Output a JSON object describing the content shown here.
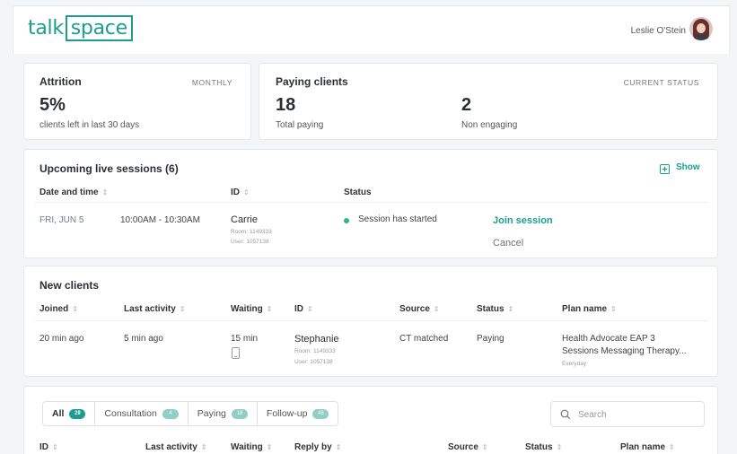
{
  "header": {
    "logo_left": "talk",
    "logo_box": "space",
    "user_name": "Leslie O'Stein"
  },
  "attrition": {
    "title": "Attrition",
    "period": "MONTHLY",
    "value": "5%",
    "caption": "clients left in last 30 days"
  },
  "paying": {
    "title": "Paying clients",
    "status_tag": "CURRENT STATUS",
    "paying_value": "18",
    "paying_caption": "Total paying",
    "non_value": "2",
    "non_caption": "Non engaging"
  },
  "sessions": {
    "title": "Upcoming live sessions (6)",
    "show_label": "Show",
    "columns": [
      "Date and time",
      "ID",
      "Status"
    ],
    "rows": [
      {
        "date": "FRI, JUN 5",
        "time": "10:00AM - 10:30AM",
        "name": "Carrie",
        "room": "Room: 1149333",
        "user": "User: 1057138",
        "status": "Session has started",
        "join": "Join session",
        "cancel": "Cancel"
      }
    ]
  },
  "new_clients": {
    "title": "New clients",
    "columns": [
      "Joined",
      "Last activity",
      "Waiting",
      "ID",
      "Source",
      "Status",
      "Plan name"
    ],
    "rows": [
      {
        "joined": "20 min ago",
        "last_activity": "5 min ago",
        "waiting": "15 min",
        "name": "Stephanie",
        "room": "Room: 1149333",
        "user": "User: 1057138",
        "source": "CT matched",
        "status": "Paying",
        "plan_line1": "Health Advocate EAP 3",
        "plan_line2": "Sessions Messaging Therapy...",
        "plan_sub": "Everyday"
      }
    ]
  },
  "clients": {
    "tabs": [
      {
        "label": "All",
        "count": "29"
      },
      {
        "label": "Consultation",
        "count": "4"
      },
      {
        "label": "Paying",
        "count": "18"
      },
      {
        "label": "Follow-up",
        "count": "48"
      }
    ],
    "search_placeholder": "Search",
    "columns": [
      "ID",
      "Last activity",
      "Waiting",
      "Reply by",
      "Source",
      "Status",
      "Plan name"
    ]
  },
  "colors": {
    "accent": "#1a9e8f",
    "status_green": "#2db87d"
  }
}
